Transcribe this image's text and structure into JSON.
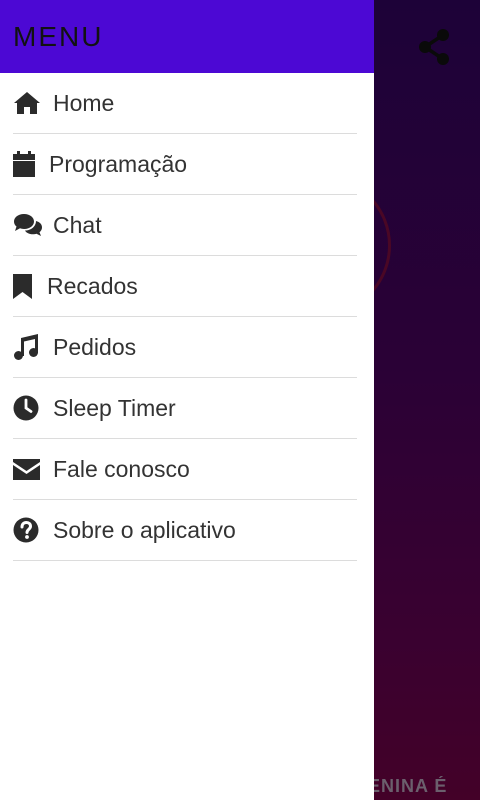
{
  "colors": {
    "header_bg": "#4c08d4",
    "drawer_bg": "#ffffff",
    "backdrop_top": "#1d0238",
    "backdrop_bottom": "#430128",
    "icon": "#2b2b2b"
  },
  "drawer": {
    "title": "MENU",
    "items": [
      {
        "label": "Home",
        "icon": "home-icon"
      },
      {
        "label": "Programação",
        "icon": "calendar-icon"
      },
      {
        "label": "Chat",
        "icon": "chat-icon"
      },
      {
        "label": "Recados",
        "icon": "bookmark-icon"
      },
      {
        "label": "Pedidos",
        "icon": "music-icon"
      },
      {
        "label": "Sleep Timer",
        "icon": "clock-icon"
      },
      {
        "label": "Fale conosco",
        "icon": "envelope-icon"
      },
      {
        "label": "Sobre o aplicativo",
        "icon": "question-circle-icon"
      }
    ]
  },
  "background": {
    "share_icon": "share-icon",
    "partial_text": "IENINA É"
  }
}
